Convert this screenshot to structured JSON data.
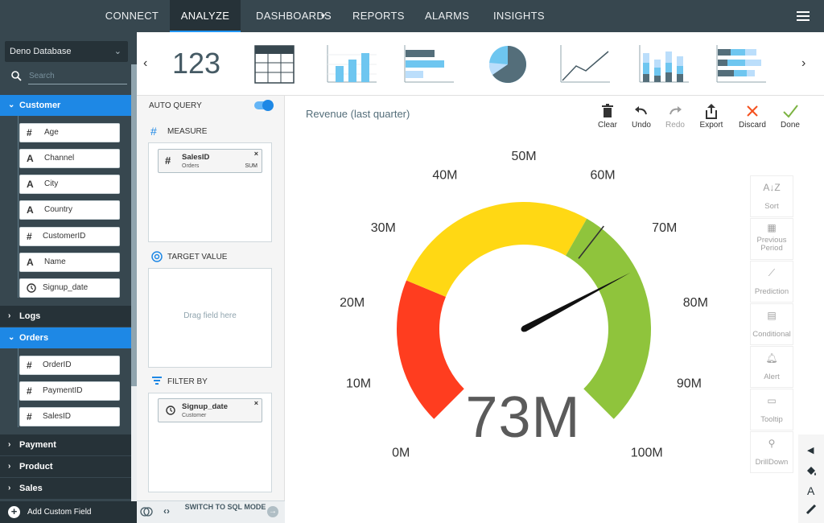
{
  "nav": {
    "items": [
      "CONNECT",
      "ANALYZE",
      "DASHBOARDS",
      "REPORTS",
      "ALARMS",
      "INSIGHTS"
    ],
    "active": "ANALYZE",
    "dropdown_icon": "caret-down-icon",
    "menu_icon": "hamburger-icon"
  },
  "sidebar": {
    "database": "Deno Database",
    "search_placeholder": "Search",
    "groups": {
      "customer": {
        "label": "Customer",
        "fields": [
          {
            "type": "#",
            "name": "Age"
          },
          {
            "type": "A",
            "name": "Channel"
          },
          {
            "type": "A",
            "name": "City"
          },
          {
            "type": "A",
            "name": "Country"
          },
          {
            "type": "#",
            "name": "CustomerID"
          },
          {
            "type": "A",
            "name": "Name"
          },
          {
            "type": "clock",
            "name": "Signup_date"
          }
        ]
      },
      "logs": {
        "label": "Logs"
      },
      "orders": {
        "label": "Orders",
        "fields": [
          {
            "type": "#",
            "name": "OrderID"
          },
          {
            "type": "#",
            "name": "PaymentID"
          },
          {
            "type": "#",
            "name": "SalesID"
          }
        ]
      },
      "payment": {
        "label": "Payment"
      },
      "product": {
        "label": "Product"
      },
      "sales": {
        "label": "Sales"
      }
    },
    "add_custom_field": "Add Custom Field"
  },
  "toolbar": {
    "chart_types": [
      "number",
      "table",
      "bar",
      "horizontal-bar",
      "pie",
      "line",
      "stacked-bar",
      "stacked-horizontal-bar"
    ],
    "number_label": "123"
  },
  "query": {
    "auto_query": "AUTO QUERY",
    "auto_query_on": true,
    "measure": {
      "label": "MEASURE",
      "chip": {
        "name": "SalesID",
        "source": "Orders",
        "agg": "SUM"
      }
    },
    "target": {
      "label": "TARGET VALUE",
      "placeholder": "Drag field here"
    },
    "filter": {
      "label": "FILTER BY",
      "chip": {
        "name": "Signup_date",
        "source": "Customer"
      }
    },
    "switch_sql": "SWITCH TO SQL MODE"
  },
  "chart": {
    "title": "Revenue (last quarter)",
    "value_label": "73M",
    "value": 73,
    "target_marker": 64,
    "scale": {
      "min": 0,
      "max": 100,
      "ticks": [
        "0M",
        "10M",
        "20M",
        "30M",
        "40M",
        "50M",
        "60M",
        "70M",
        "80M",
        "90M",
        "100M"
      ]
    },
    "bands": [
      {
        "from": 0,
        "to": 25,
        "color": "#ff3d1f"
      },
      {
        "from": 25,
        "to": 61,
        "color": "#ffd814"
      },
      {
        "from": 61,
        "to": 100,
        "color": "#8fc43c"
      }
    ]
  },
  "actions": [
    {
      "label": "Clear",
      "icon": "trash-icon",
      "enabled": true
    },
    {
      "label": "Undo",
      "icon": "undo-icon",
      "enabled": true
    },
    {
      "label": "Redo",
      "icon": "redo-icon",
      "enabled": false
    },
    {
      "label": "Export",
      "icon": "export-icon",
      "enabled": true
    },
    {
      "label": "Discard",
      "icon": "close-icon",
      "enabled": true,
      "color": "#f4511e"
    },
    {
      "label": "Done",
      "icon": "check-icon",
      "enabled": true,
      "color": "#7cb342"
    }
  ],
  "right_tools": [
    "Sort",
    "Previous Period",
    "Prediction",
    "Conditional",
    "Alert",
    "Tooltip",
    "DrillDown"
  ],
  "style_tools": [
    "collapse-left-icon",
    "paint-bucket-icon",
    "text-icon",
    "pencil-icon"
  ]
}
